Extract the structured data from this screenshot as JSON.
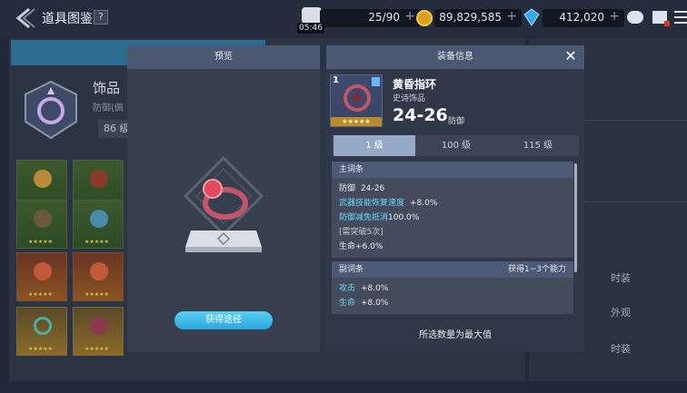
{
  "header": {
    "title": "道具图鉴",
    "help_label": "?",
    "stamina": "25/90",
    "gold": "89,829,585",
    "gems": "412,020",
    "timer": "05:46",
    "plus": "+"
  },
  "background": {
    "category_title": "饰品",
    "category_sub": "防御(佩",
    "level_label": "86 级",
    "right_labels": [
      "时装",
      "外观",
      "时装"
    ]
  },
  "preview": {
    "title": "预览",
    "acquire_button": "获得途径"
  },
  "equip": {
    "title": "装备信息",
    "close_label": "✕",
    "thumb_level": "1",
    "thumb_stars": "★★★★★",
    "name": "黄昏指环",
    "grade": "史诗饰品",
    "range": "24-26",
    "range_unit": "防御",
    "level_tabs": [
      "1 级",
      "100 级",
      "115 级"
    ],
    "main_section": {
      "title": "主词条",
      "stats": [
        {
          "key": "防御",
          "value": "24-26",
          "highlight": false
        },
        {
          "key": "武器技能恢复速度",
          "value": "+8.0%",
          "highlight": true
        },
        {
          "key": "防御减免抵消",
          "value": "100.0%",
          "highlight": true
        },
        {
          "key": "[需突破5次]",
          "value": "",
          "highlight": false
        },
        {
          "key": "生命",
          "value": "+6.0%",
          "highlight": false
        }
      ]
    },
    "sub_section": {
      "title": "副词条",
      "right_text": "获得1~3个能力",
      "stats": [
        {
          "key": "攻击",
          "value": "+8.0%",
          "highlight": true
        },
        {
          "key": "生命",
          "value": "+8.0%",
          "highlight": true
        }
      ]
    },
    "footer": "所选数量为最大值"
  },
  "colors": {
    "accent": "#2aa6df",
    "highlight_text": "#6cd7ff",
    "header_blue": "#4a5871"
  }
}
